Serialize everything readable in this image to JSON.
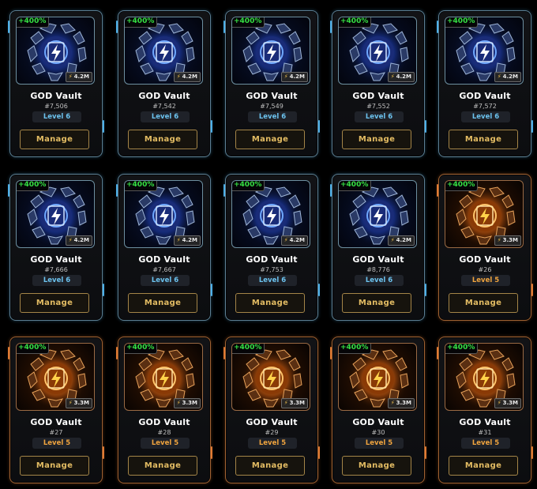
{
  "cards": [
    {
      "bonus": "+400%",
      "power": "4.2M",
      "name": "GOD Vault",
      "number": "#7,506",
      "level": "Level 6",
      "action": "Manage",
      "tier": "blue"
    },
    {
      "bonus": "+400%",
      "power": "4.2M",
      "name": "GOD Vault",
      "number": "#7,542",
      "level": "Level 6",
      "action": "Manage",
      "tier": "blue"
    },
    {
      "bonus": "+400%",
      "power": "4.2M",
      "name": "GOD Vault",
      "number": "#7,549",
      "level": "Level 6",
      "action": "Manage",
      "tier": "blue"
    },
    {
      "bonus": "+400%",
      "power": "4.2M",
      "name": "GOD Vault",
      "number": "#7,552",
      "level": "Level 6",
      "action": "Manage",
      "tier": "blue"
    },
    {
      "bonus": "+400%",
      "power": "4.2M",
      "name": "GOD Vault",
      "number": "#7,572",
      "level": "Level 6",
      "action": "Manage",
      "tier": "blue"
    },
    {
      "bonus": "+400%",
      "power": "4.2M",
      "name": "GOD Vault",
      "number": "#7,666",
      "level": "Level 6",
      "action": "Manage",
      "tier": "blue"
    },
    {
      "bonus": "+400%",
      "power": "4.2M",
      "name": "GOD Vault",
      "number": "#7,667",
      "level": "Level 6",
      "action": "Manage",
      "tier": "blue"
    },
    {
      "bonus": "+400%",
      "power": "4.2M",
      "name": "GOD Vault",
      "number": "#7,753",
      "level": "Level 6",
      "action": "Manage",
      "tier": "blue"
    },
    {
      "bonus": "+400%",
      "power": "4.2M",
      "name": "GOD Vault",
      "number": "#8,776",
      "level": "Level 6",
      "action": "Manage",
      "tier": "blue"
    },
    {
      "bonus": "+400%",
      "power": "3.3M",
      "name": "GOD Vault",
      "number": "#26",
      "level": "Level 5",
      "action": "Manage",
      "tier": "orange"
    },
    {
      "bonus": "+400%",
      "power": "3.3M",
      "name": "GOD Vault",
      "number": "#27",
      "level": "Level 5",
      "action": "Manage",
      "tier": "orange"
    },
    {
      "bonus": "+400%",
      "power": "3.3M",
      "name": "GOD Vault",
      "number": "#28",
      "level": "Level 5",
      "action": "Manage",
      "tier": "orange"
    },
    {
      "bonus": "+400%",
      "power": "3.3M",
      "name": "GOD Vault",
      "number": "#29",
      "level": "Level 5",
      "action": "Manage",
      "tier": "orange"
    },
    {
      "bonus": "+400%",
      "power": "3.3M",
      "name": "GOD Vault",
      "number": "#30",
      "level": "Level 5",
      "action": "Manage",
      "tier": "orange"
    },
    {
      "bonus": "+400%",
      "power": "3.3M",
      "name": "GOD Vault",
      "number": "#31",
      "level": "Level 5",
      "action": "Manage",
      "tier": "orange"
    }
  ],
  "colors": {
    "blue_glow": "#4db0e8",
    "blue_level_text": "#6cc3ef",
    "orange_glow": "#e07a32",
    "orange_level_text": "#f0a43e",
    "bonus_text": "#35e043",
    "manage_text": "#e3bc63"
  },
  "icons": {
    "vault": "vault-orb-icon",
    "power": "lightning-bolt-icon"
  }
}
